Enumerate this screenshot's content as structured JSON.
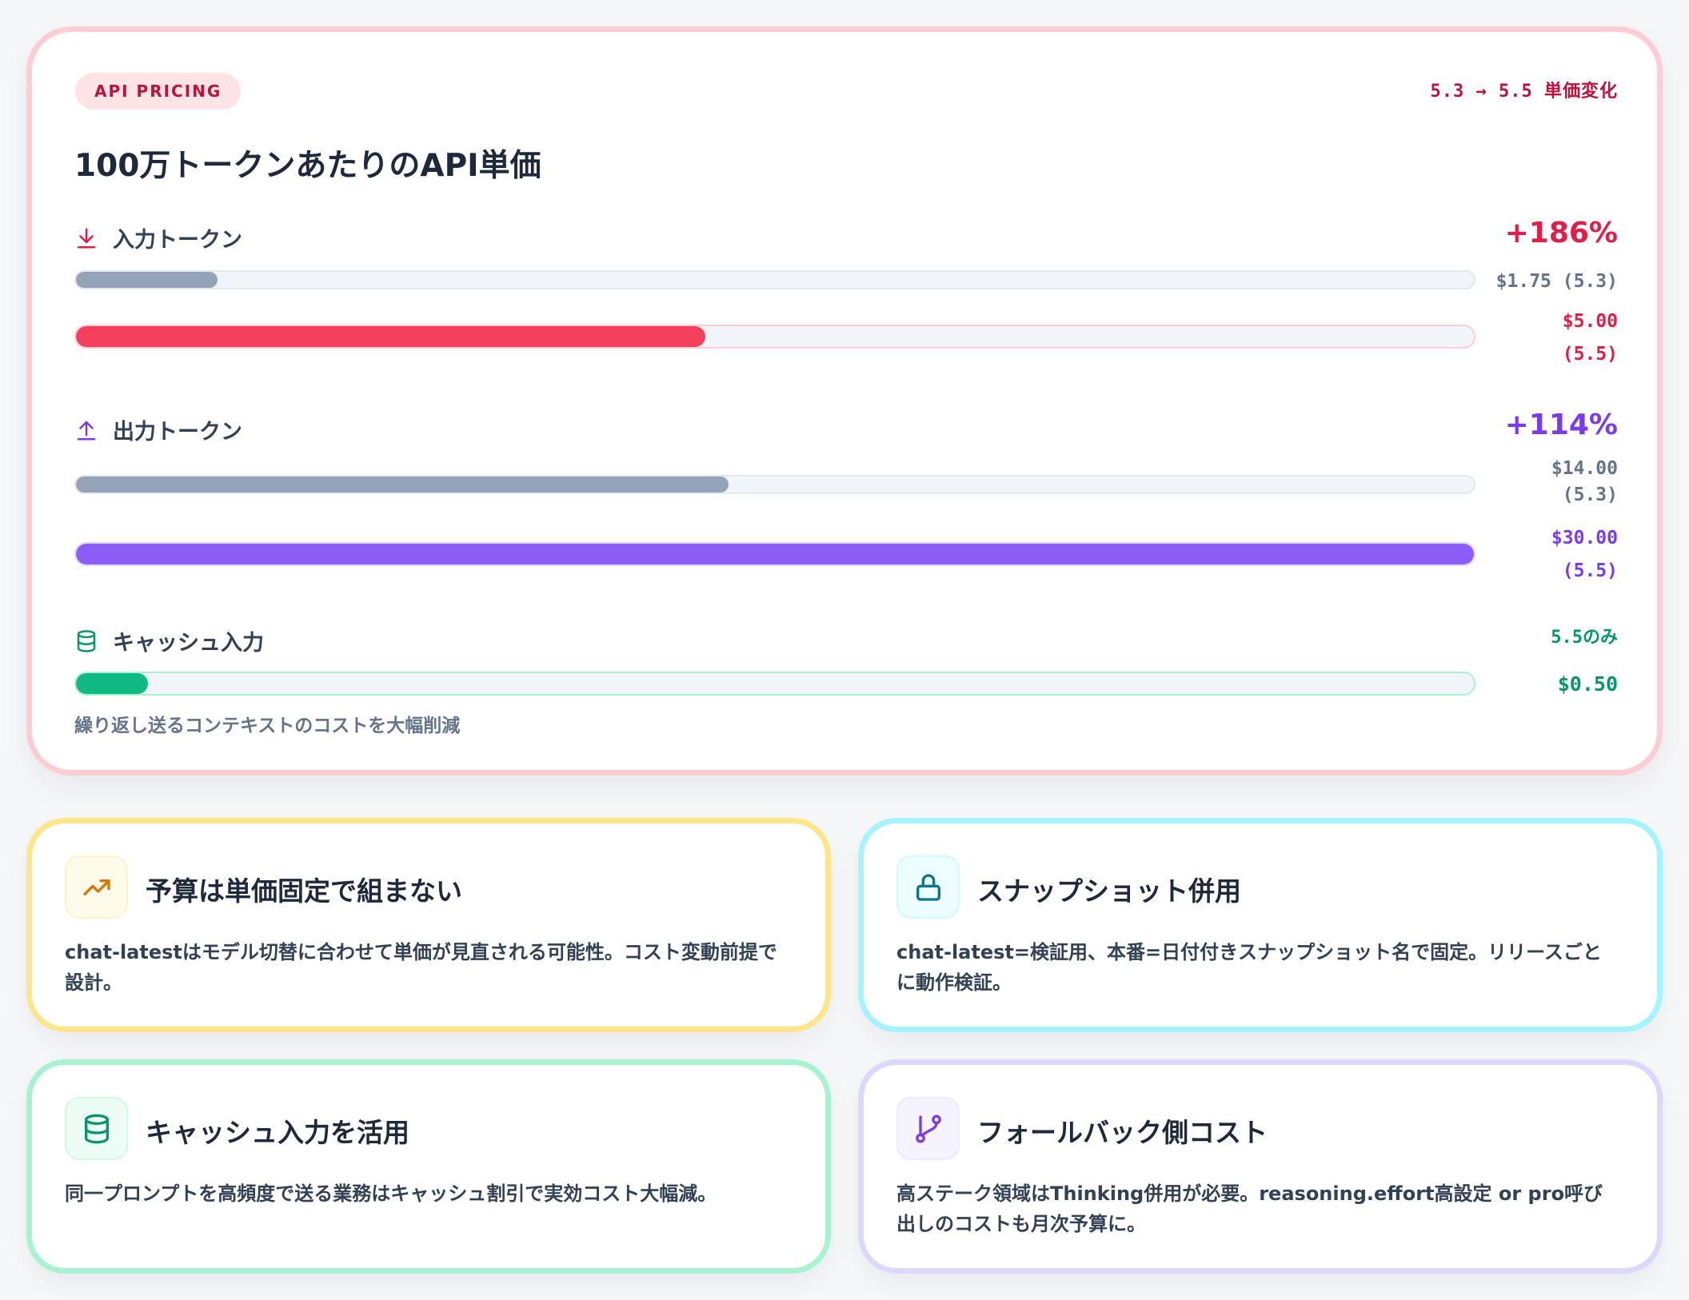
{
  "colors": {
    "rose": "#e11d48",
    "rose_fill": "#f43f5e",
    "purple": "#7c3aed",
    "purple_fill": "#8b5cf6",
    "green": "#059669",
    "green_fill": "#10b981",
    "slate_fill": "#94a3b8",
    "amber": "#d97706",
    "cyan": "#0e7490"
  },
  "pricing": {
    "badge": "API PRICING",
    "version_change": "5.3 → 5.5 単価変化",
    "title": "100万トークンあたりのAPI単価",
    "input": {
      "icon": "download-icon",
      "label": "入力トークン",
      "pct": "+186%",
      "old_price": "$1.75 (5.3)",
      "new_price_line1": "$5.00",
      "new_price_line2": "(5.5)",
      "old_value": 1.75,
      "new_value": 5.0
    },
    "output": {
      "icon": "upload-icon",
      "label": "出力トークン",
      "pct": "+114%",
      "old_price_line1": "$14.00",
      "old_price_line2": "(5.3)",
      "new_price_line1": "$30.00",
      "new_price_line2": "(5.5)",
      "old_value": 14.0,
      "new_value": 30.0
    },
    "cache": {
      "icon": "database-icon",
      "label": "キャッシュ入力",
      "note": "5.5のみ",
      "price": "$0.50",
      "value": 0.5
    },
    "scale_max": 30.0,
    "caption": "繰り返し送るコンテキストのコストを大幅削減"
  },
  "tips": [
    {
      "icon": "trending-up-icon",
      "title": "予算は単価固定で組まない",
      "body": "chat-latestはモデル切替に合わせて単価が見直される可能性。コスト変動前提で設計。"
    },
    {
      "icon": "lock-icon",
      "title": "スナップショット併用",
      "body": "chat-latest=検証用、本番=日付付きスナップショット名で固定。リリースごとに動作検証。"
    },
    {
      "icon": "database-icon",
      "title": "キャッシュ入力を活用",
      "body": "同一プロンプトを高頻度で送る業務はキャッシュ割引で実効コスト大幅減。"
    },
    {
      "icon": "git-branch-icon",
      "title": "フォールバック側コスト",
      "body": "高ステーク領域はThinking併用が必要。reasoning.effort高設定 or pro呼び出しのコストも月次予算に。"
    }
  ]
}
